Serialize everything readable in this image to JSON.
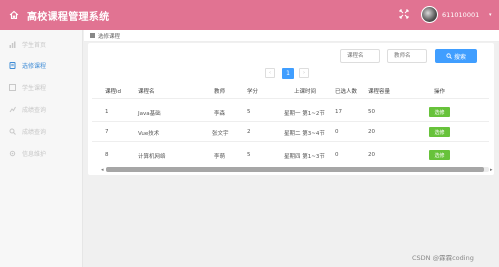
{
  "header": {
    "title": "高校课程管理系统",
    "user_id": "611010001",
    "accent": "#e17392"
  },
  "sidebar": {
    "items": [
      {
        "label": "学生首页",
        "icon": "chart-icon"
      },
      {
        "label": "选修课程",
        "icon": "book-icon"
      },
      {
        "label": "学生课程",
        "icon": "course-icon"
      },
      {
        "label": "成绩查询",
        "icon": "grade-icon"
      },
      {
        "label": "成绩查询",
        "icon": "search-icon"
      },
      {
        "label": "信息维护",
        "icon": "settings-icon"
      }
    ],
    "active_index": 1
  },
  "breadcrumb": {
    "current": "选修课程"
  },
  "search": {
    "course_placeholder": "课程名",
    "teacher_placeholder": "教师名",
    "button_label": "搜索"
  },
  "pagination": {
    "prev": "‹",
    "current_page": "1",
    "next": "›"
  },
  "table": {
    "columns": [
      "课程id",
      "课程名",
      "教师",
      "学分",
      "上课时间",
      "已选人数",
      "课程容量",
      "操作"
    ],
    "rows": [
      {
        "id": "1",
        "name": "Java基础",
        "teacher": "李森",
        "credit": "5",
        "time": "星期一 第1~2节",
        "selected": "17",
        "capacity": "50",
        "action": "选修"
      },
      {
        "id": "7",
        "name": "Vue技术",
        "teacher": "张文宇",
        "credit": "2",
        "time": "星期二 第3~4节",
        "selected": "0",
        "capacity": "20",
        "action": "选修"
      },
      {
        "id": "8",
        "name": "计算机网络",
        "teacher": "李萌",
        "credit": "5",
        "time": "星期四 第1~3节",
        "selected": "0",
        "capacity": "20",
        "action": "选修"
      }
    ]
  },
  "watermark": "CSDN @霖霖coding",
  "colors": {
    "primary": "#409eff",
    "success": "#67c23a",
    "active_side": "#3f8cd6"
  }
}
